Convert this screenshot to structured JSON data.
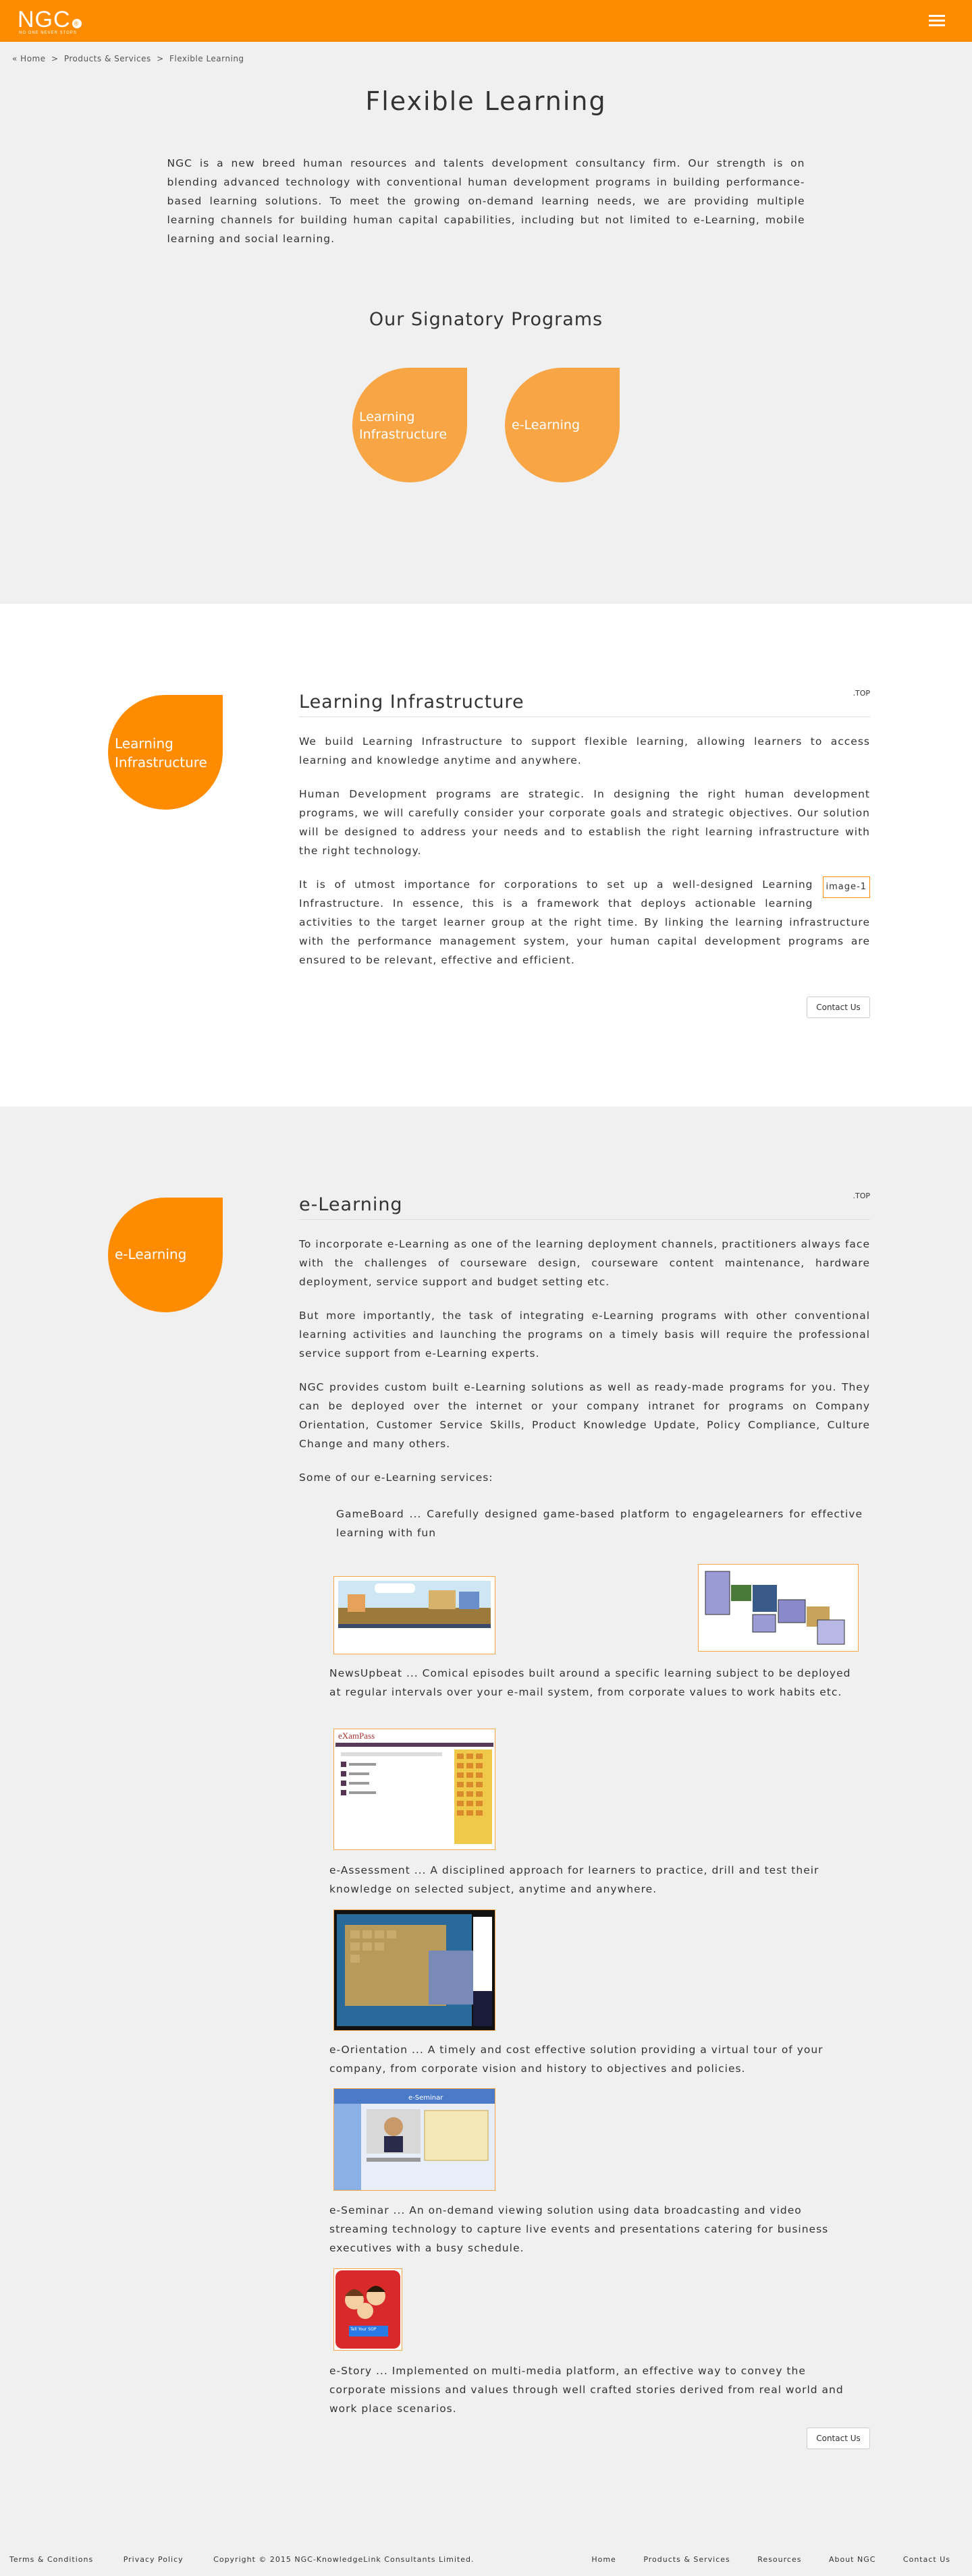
{
  "header": {
    "logo_text": "NGC",
    "logo_mark": "®",
    "logo_tagline": "NO ONE NEVER STOPS",
    "menu_icon": "hamburger-icon"
  },
  "breadcrumb": {
    "home_icon": "home-icon",
    "home": "Home",
    "sep1": ">",
    "products": "Products & Services",
    "sep2": ">",
    "current": "Flexible Learning"
  },
  "hero": {
    "title": "Flexible Learning",
    "intro": "NGC is a new breed human resources and talents development consultancy firm. Our strength is on blending advanced technology with conventional human development programs in building performance-based learning solutions.  To meet the growing on-demand learning needs, we are providing multiple learning channels for building human capital capabilities, including but not limited to e-Learning, mobile learning and social learning.",
    "programs_title": "Our Signatory Programs",
    "program1": "Learning Infrastructure",
    "program2": "e-Learning"
  },
  "infrastructure": {
    "drop_label": "Learning Infrastructure",
    "title": "Learning Infrastructure",
    "top": ".TOP",
    "p1": "We build Learning Infrastructure to support flexible learning, allowing learners to access learning and knowledge anytime and anywhere.",
    "p2": "Human Development programs are strategic.  In designing the right human development programs, we will carefully consider your corporate goals and strategic objectives.  Our solution will be designed to address your needs and to establish the right learning infrastructure with the right technology.",
    "image_placeholder": "image-1",
    "p3": "It is of utmost importance for corporations to set up a well-designed Learning Infrastructure.  In essence, this is a framework that deploys actionable learning activities to the target learner group at the right time.  By linking the learning infrastructure with the performance management system, your human capital development programs are ensured to be relevant, effective and efficient.",
    "contact": "Contact Us"
  },
  "elearning": {
    "drop_label": "e-Learning",
    "title": "e-Learning",
    "top": ".TOP",
    "p1": "To incorporate e-Learning as one of the learning deployment channels, practitioners always face with the challenges of courseware design, courseware content maintenance, hardware deployment, service support and budget setting etc.",
    "p2": "But more importantly, the task of integrating e-Learning programs with other conventional learning activities and launching the programs on a timely basis will require the professional service support from e-Learning experts.",
    "p3": "NGC provides custom built e-Learning solutions as well as ready-made programs for you.  They can be deployed over the internet or your company intranet for programs on Company Orientation, Customer Service Skills, Product Knowledge Update, Policy Compliance, Culture Change and many others.",
    "services_intro": "Some of our e-Learning services:",
    "gameboard": "GameBoard ... Carefully designed game-based platform to engagelearners for effective learning with fun",
    "newsupbeat": "NewsUpbeat ... Comical episodes built around a specific learning subject to be deployed at regular intervals over your e-mail system, from corporate values to work habits etc.",
    "assessment": "e-Assessment ... A disciplined approach for learners to practice, drill and test their knowledge on selected subject, anytime and anywhere.",
    "orientation": "e-Orientation ... A timely and cost effective solution providing a virtual tour of your company, from corporate vision and history to objectives and policies.",
    "seminar": "e-Seminar ... An on-demand viewing solution using data broadcasting and video streaming technology to capture live events and presentations catering for business executives with a busy schedule.",
    "story": "e-Story ... Implemented on multi-media platform, an effective way to convey the corporate missions and values through well crafted stories derived from real world and work place scenarios.",
    "exam_logo": "eXamPass",
    "seminar_banner": "e-Seminar",
    "story_caption": "Tell Your SOP",
    "contact": "Contact Us"
  },
  "footer": {
    "terms": "Terms & Conditions",
    "privacy": "Privacy Policy",
    "copyright": "Copyright © 2015 NGC-KnowledgeLink Consultants Limited.",
    "nav": [
      "Home",
      "Products & Services",
      "Resources",
      "About NGC",
      "Contact Us"
    ]
  },
  "colors": {
    "brand": "#ff8c00",
    "drop_light": "#f7a545",
    "background": "#f0f0f0",
    "section_white": "#ffffff"
  }
}
